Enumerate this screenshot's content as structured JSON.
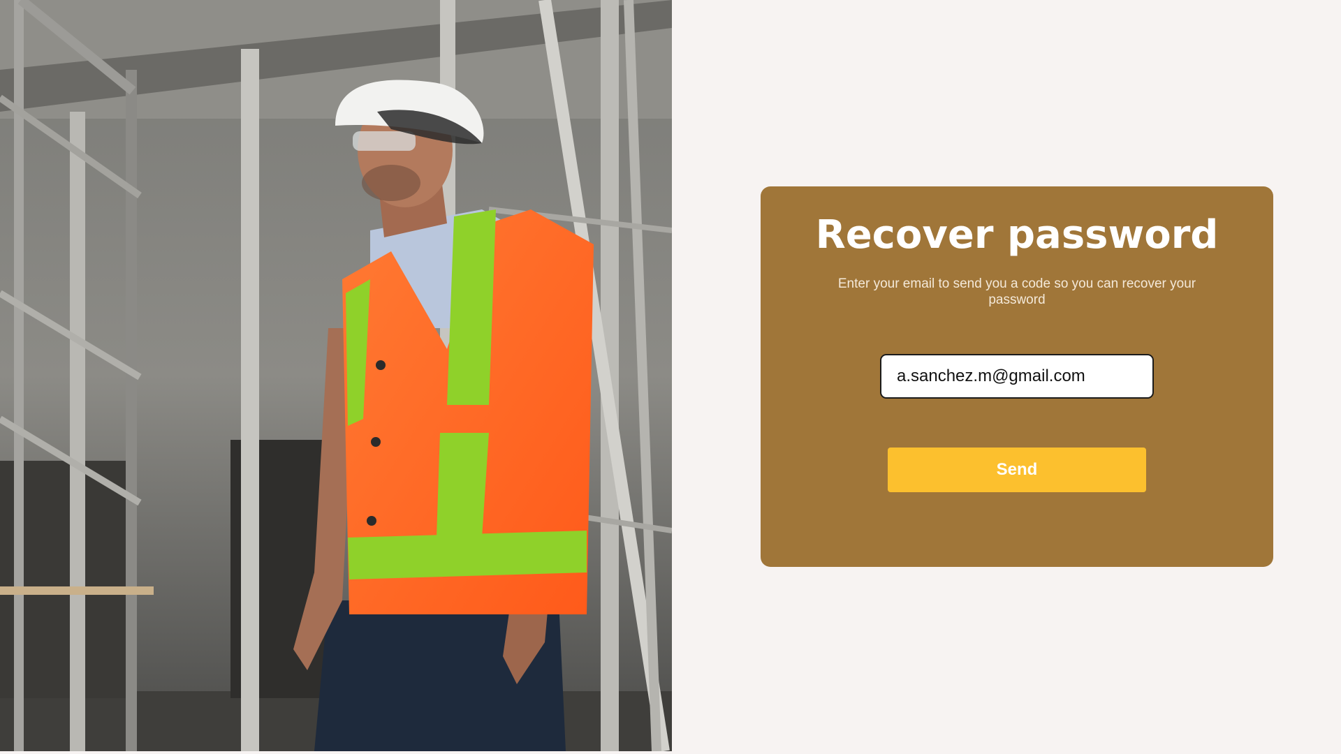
{
  "hero": {
    "image_alt": "Construction worker in hard hat and safety vest"
  },
  "recover": {
    "title": "Recover password",
    "subtitle": "Enter your email to send you a code so you can recover your password",
    "email_value": "a.sanchez.m@gmail.com",
    "send_label": "Send"
  },
  "colors": {
    "background": "#f7f3f2",
    "card": "#a07639",
    "button": "#fcc02e"
  }
}
